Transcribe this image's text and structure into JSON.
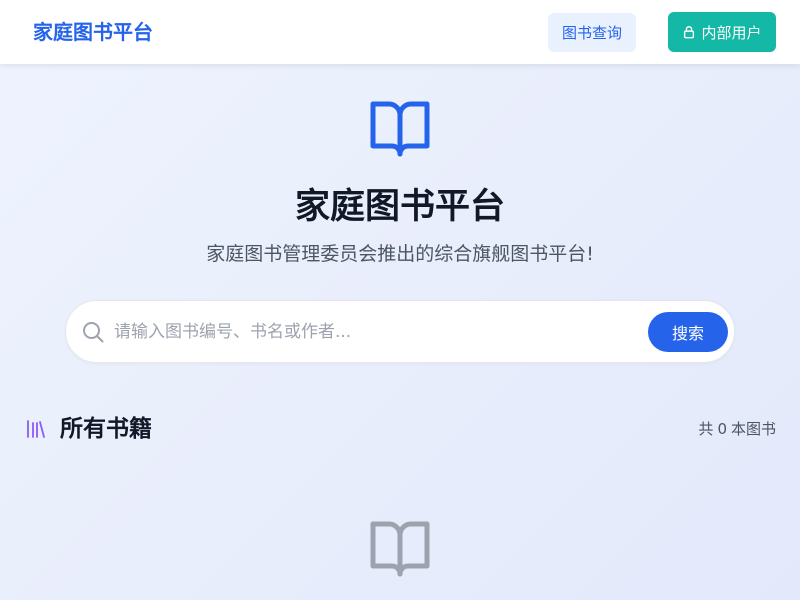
{
  "header": {
    "brand": "家庭图书平台",
    "query_button": "图书查询",
    "internal_button": "内部用户"
  },
  "hero": {
    "icon": "open-book-icon",
    "title": "家庭图书平台",
    "subtitle": "家庭图书管理委员会推出的综合旗舰图书平台!"
  },
  "search": {
    "placeholder": "请输入图书编号、书名或作者...",
    "button": "搜索"
  },
  "section": {
    "icon": "library-icon",
    "title": "所有书籍",
    "count_prefix": "共",
    "count": "0",
    "count_suffix": "本图书"
  },
  "empty": {
    "icon": "open-book-icon"
  },
  "colors": {
    "primary": "#2563eb",
    "teal": "#14b8a6",
    "library_icon": "#8b5cf6",
    "empty_icon": "#9ca3af"
  }
}
